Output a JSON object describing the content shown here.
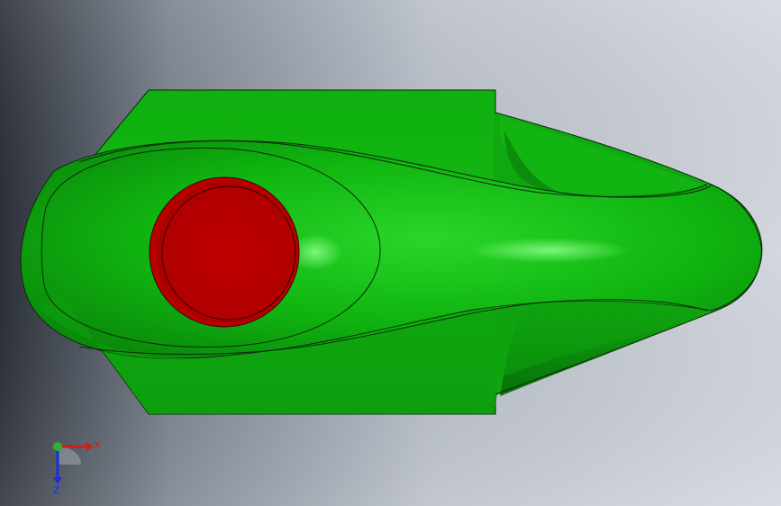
{
  "viewport": {
    "background_gradient": [
      "#2b3039",
      "#8b939e",
      "#c3c8d2",
      "#d3d7de"
    ]
  },
  "model": {
    "body_color": "#0fb30f",
    "body_highlight_color": "#6ff06f",
    "body_shadow_color": "#0a6a0a",
    "face_color": "#c00000",
    "face_rim_color": "#8a0000",
    "edge_color": "#0a2a0a"
  },
  "triad": {
    "x_label": "X",
    "z_label": "Z",
    "x_color": "#cc1e1e",
    "z_color": "#1b2ee0",
    "origin_color": "#2fb32f"
  }
}
